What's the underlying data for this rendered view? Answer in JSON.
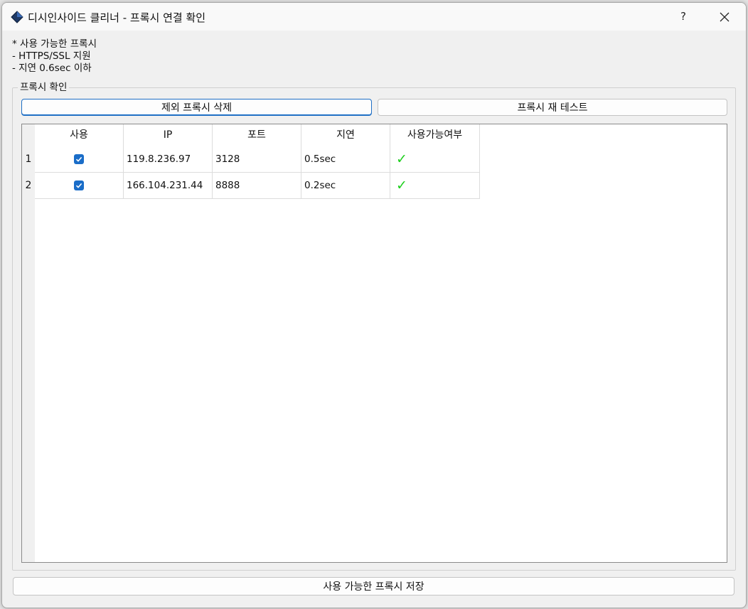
{
  "window": {
    "title": "디시인사이드 클리너 - 프록시 연결 확인",
    "help_label": "?",
    "icon": "diamond-app-icon"
  },
  "info_lines": [
    "* 사용 가능한 프록시",
    "- HTTPS/SSL 지원",
    "- 지연 0.6sec 이하"
  ],
  "group": {
    "title": "프록시 확인",
    "delete_button": "제외 프록시 삭제",
    "retest_button": "프록시 재 테스트"
  },
  "table": {
    "columns": [
      "사용",
      "IP",
      "포트",
      "지연",
      "사용가능여부"
    ],
    "rows": [
      {
        "index": "1",
        "use": true,
        "ip": "119.8.236.97",
        "port": "3128",
        "latency": "0.5sec",
        "available": "✓"
      },
      {
        "index": "2",
        "use": true,
        "ip": "166.104.231.44",
        "port": "8888",
        "latency": "0.2sec",
        "available": "✓"
      }
    ]
  },
  "save_button": "사용 가능한 프록시 저장",
  "colors": {
    "accent": "#1a6dc8",
    "check_green": "#1ecf1e",
    "window_bg": "#f0f0f0"
  }
}
